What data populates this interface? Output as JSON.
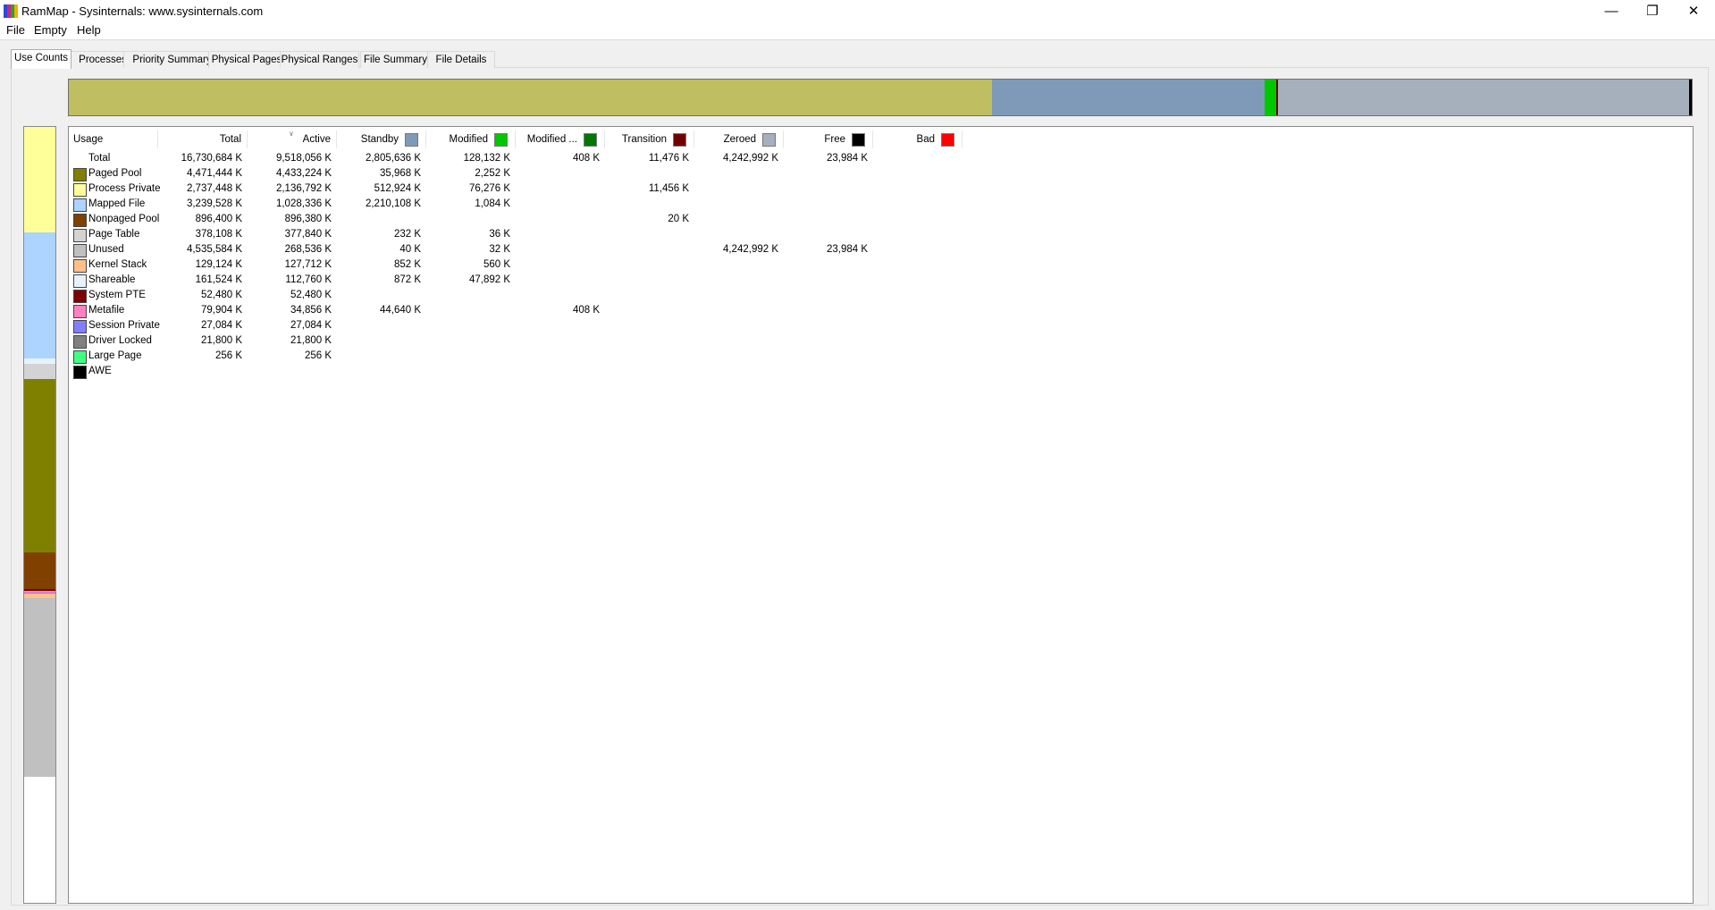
{
  "window": {
    "title": "RamMap - Sysinternals: www.sysinternals.com"
  },
  "icons": {
    "app": "rammap-app-icon",
    "minimize": "minimize-icon",
    "restore": "restore-icon",
    "close": "close-icon",
    "sort": "sort-arrow-icon"
  },
  "menu": [
    "File",
    "Empty",
    "Help"
  ],
  "tabs": [
    "Use Counts",
    "Processes",
    "Priority Summary",
    "Physical Pages",
    "Physical Ranges",
    "File Summary",
    "File Details"
  ],
  "active_tab": "Use Counts",
  "columns": [
    {
      "label": "Usage",
      "color": null
    },
    {
      "label": "Total",
      "color": null
    },
    {
      "label": "Active",
      "color": null,
      "sorted": true
    },
    {
      "label": "Standby",
      "color": "#7f9ab8"
    },
    {
      "label": "Modified",
      "color": "#00c800"
    },
    {
      "label": "Modified ...",
      "color": "#007800"
    },
    {
      "label": "Transition",
      "color": "#700000"
    },
    {
      "label": "Zeroed",
      "color": "#a5b0bc"
    },
    {
      "label": "Free",
      "color": "#000000"
    },
    {
      "label": "Bad",
      "color": "#ff0000"
    }
  ],
  "rows": [
    {
      "name": "Total",
      "color": null,
      "values": [
        "16,730,684 K",
        "9,518,056 K",
        "2,805,636 K",
        "128,132 K",
        "408 K",
        "11,476 K",
        "4,242,992 K",
        "23,984 K",
        ""
      ]
    },
    {
      "name": "Paged Pool",
      "color": "#808000",
      "values": [
        "4,471,444 K",
        "4,433,224 K",
        "35,968 K",
        "2,252 K",
        "",
        "",
        "",
        "",
        ""
      ]
    },
    {
      "name": "Process Private",
      "color": "#ffff99",
      "values": [
        "2,737,448 K",
        "2,136,792 K",
        "512,924 K",
        "76,276 K",
        "",
        "11,456 K",
        "",
        "",
        ""
      ]
    },
    {
      "name": "Mapped File",
      "color": "#add3ff",
      "values": [
        "3,239,528 K",
        "1,028,336 K",
        "2,210,108 K",
        "1,084 K",
        "",
        "",
        "",
        "",
        ""
      ]
    },
    {
      "name": "Nonpaged Pool",
      "color": "#804000",
      "values": [
        "896,400 K",
        "896,380 K",
        "",
        "",
        "",
        "20 K",
        "",
        "",
        ""
      ]
    },
    {
      "name": "Page Table",
      "color": "#d3d3d3",
      "values": [
        "378,108 K",
        "377,840 K",
        "232 K",
        "36 K",
        "",
        "",
        "",
        "",
        ""
      ]
    },
    {
      "name": "Unused",
      "color": "#c0c0c0",
      "values": [
        "4,535,584 K",
        "268,536 K",
        "40 K",
        "32 K",
        "",
        "",
        "4,242,992 K",
        "23,984 K",
        ""
      ]
    },
    {
      "name": "Kernel Stack",
      "color": "#ffc08a",
      "values": [
        "129,124 K",
        "127,712 K",
        "852 K",
        "560 K",
        "",
        "",
        "",
        "",
        ""
      ]
    },
    {
      "name": "Shareable",
      "color": "#e8f2ff",
      "values": [
        "161,524 K",
        "112,760 K",
        "872 K",
        "47,892 K",
        "",
        "",
        "",
        "",
        ""
      ]
    },
    {
      "name": "System PTE",
      "color": "#800000",
      "values": [
        "52,480 K",
        "52,480 K",
        "",
        "",
        "",
        "",
        "",
        "",
        ""
      ]
    },
    {
      "name": "Metafile",
      "color": "#ff80c0",
      "values": [
        "79,904 K",
        "34,856 K",
        "44,640 K",
        "",
        "408 K",
        "",
        "",
        "",
        ""
      ]
    },
    {
      "name": "Session Private",
      "color": "#8080ff",
      "values": [
        "27,084 K",
        "27,084 K",
        "",
        "",
        "",
        "",
        "",
        "",
        ""
      ]
    },
    {
      "name": "Driver Locked",
      "color": "#808080",
      "values": [
        "21,800 K",
        "21,800 K",
        "",
        "",
        "",
        "",
        "",
        "",
        ""
      ]
    },
    {
      "name": "Large Page",
      "color": "#40ff80",
      "values": [
        "256 K",
        "256 K",
        "",
        "",
        "",
        "",
        "",
        "",
        ""
      ]
    },
    {
      "name": "AWE",
      "color": "#000000",
      "values": [
        "",
        "",
        "",
        "",
        "",
        "",
        "",
        "",
        ""
      ]
    }
  ],
  "memory_bar_segments": [
    {
      "fraction": 0.568838,
      "color": "#bfbe60"
    },
    {
      "fraction": 0.167694,
      "color": "#7f9ab8"
    },
    {
      "fraction": 0.007658,
      "color": "#00c800"
    },
    {
      "fraction": 2.4e-05,
      "color": "#007800"
    },
    {
      "fraction": 0.000686,
      "color": "#700000"
    },
    {
      "fraction": 0.253586,
      "color": "#a5b0bc"
    },
    {
      "fraction": 0.001433,
      "color": "#000000"
    }
  ],
  "usage_bar_segments": [
    {
      "name": "Process Private",
      "fraction": 0.1364,
      "color": "#ffff99"
    },
    {
      "name": "Mapped File",
      "fraction": 0.1623,
      "color": "#add3ff"
    },
    {
      "name": "Shareable",
      "fraction": 0.0071,
      "color": "#e8f2ff"
    },
    {
      "name": "Page Table",
      "fraction": 0.0188,
      "color": "#d3d3d3"
    },
    {
      "name": "Paged Pool",
      "fraction": 0.2234,
      "color": "#808000"
    },
    {
      "name": "Nonpaged Pool",
      "fraction": 0.0476,
      "color": "#804000"
    },
    {
      "name": "System PTE",
      "fraction": 0.0023,
      "color": "#800000"
    },
    {
      "name": "Metafile",
      "fraction": 0.0023,
      "color": "#ff80c0"
    },
    {
      "name": "Session Private",
      "fraction": 0.0012,
      "color": "#8080ff"
    },
    {
      "name": "Kernel Stack",
      "fraction": 0.0058,
      "color": "#ffc08a"
    },
    {
      "name": "Unused",
      "fraction": 0.2308,
      "color": "#c0c0c0"
    }
  ]
}
